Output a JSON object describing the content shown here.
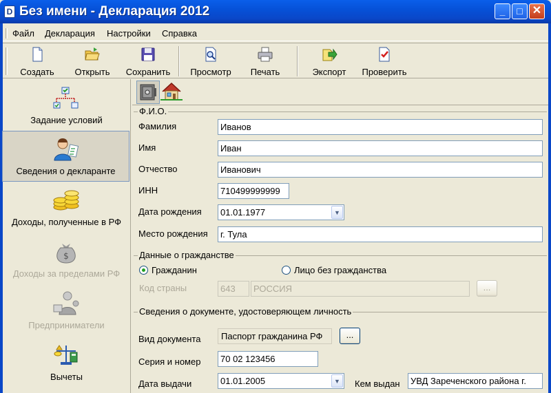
{
  "window": {
    "title": "Без имени - Декларация 2012",
    "minimize": "_",
    "maximize": "□",
    "close": "✕",
    "app_icon_letter": "D"
  },
  "menu": [
    "Файл",
    "Декларация",
    "Настройки",
    "Справка"
  ],
  "toolbar": [
    {
      "label": "Создать",
      "icon": "new-document-icon"
    },
    {
      "label": "Открыть",
      "icon": "open-folder-icon"
    },
    {
      "label": "Сохранить",
      "icon": "save-floppy-icon"
    },
    {
      "label": "Просмотр",
      "icon": "preview-icon"
    },
    {
      "label": "Печать",
      "icon": "printer-icon"
    },
    {
      "label": "Экспорт",
      "icon": "export-icon"
    },
    {
      "label": "Проверить",
      "icon": "check-document-icon"
    }
  ],
  "sidebar": [
    {
      "label": "Задание условий",
      "icon": "conditions-icon",
      "state": "normal"
    },
    {
      "label": "Сведения о декларанте",
      "icon": "declarant-icon",
      "state": "active"
    },
    {
      "label": "Доходы, полученные в РФ",
      "icon": "coins-icon",
      "state": "normal"
    },
    {
      "label": "Доходы за пределами РФ",
      "icon": "money-bag-icon",
      "state": "disabled"
    },
    {
      "label": "Предприниматели",
      "icon": "entrepreneurs-icon",
      "state": "disabled"
    },
    {
      "label": "Вычеты",
      "icon": "deductions-icon",
      "state": "normal"
    }
  ],
  "tabs": [
    {
      "icon": "safe-icon",
      "active": true
    },
    {
      "icon": "house-icon",
      "active": false
    }
  ],
  "fio": {
    "title": "Ф.И.О.",
    "surname_label": "Фамилия",
    "surname": "Иванов",
    "name_label": "Имя",
    "name": "Иван",
    "patronymic_label": "Отчество",
    "patronymic": "Иванович",
    "inn_label": "ИНН",
    "inn": "710499999999",
    "birthdate_label": "Дата рождения",
    "birthdate": "01.01.1977",
    "birthplace_label": "Место рождения",
    "birthplace": "г. Тула"
  },
  "citizenship": {
    "title": "Данные о гражданстве",
    "citizen_label": "Гражданин",
    "stateless_label": "Лицо без гражданства",
    "selected": "citizen",
    "country_code_label": "Код страны",
    "country_code": "643",
    "country_name": "РОССИЯ",
    "browse": "..."
  },
  "identity": {
    "title": "Сведения о документе, удостоверяющем личность",
    "doc_type_label": "Вид документа",
    "doc_type": "Паспорт гражданина РФ",
    "browse": "...",
    "series_label": "Серия и номер",
    "series": "70 02 123456",
    "issue_date_label": "Дата выдачи",
    "issue_date": "01.01.2005",
    "issued_by_label": "Кем выдан",
    "issued_by": "УВД Зареченского района г."
  },
  "colors": {
    "titlebar": "#0A47C8",
    "window_bg": "#ECE9D8",
    "input_border": "#7F9DB9"
  }
}
